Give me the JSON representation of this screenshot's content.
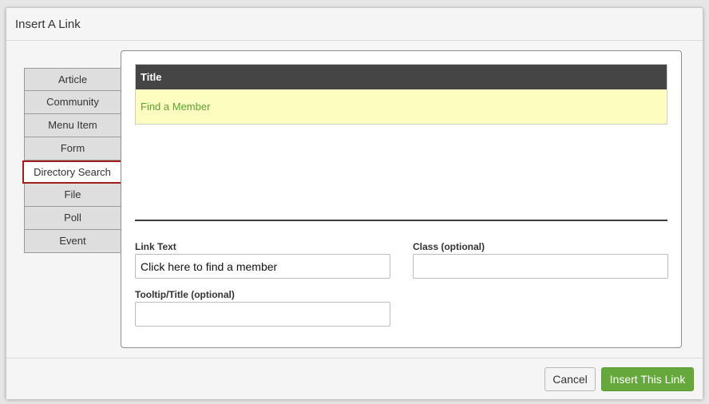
{
  "modal": {
    "title": "Insert A Link"
  },
  "tabs": [
    {
      "label": "Article"
    },
    {
      "label": "Community"
    },
    {
      "label": "Menu Item"
    },
    {
      "label": "Form"
    },
    {
      "label": "Directory Search"
    },
    {
      "label": "File"
    },
    {
      "label": "Poll"
    },
    {
      "label": "Event"
    }
  ],
  "active_tab": "Directory Search",
  "results": {
    "header": "Title",
    "rows": [
      {
        "title": "Find a Member"
      }
    ]
  },
  "form": {
    "link_text_label": "Link Text",
    "link_text_value": "Click here to find a member",
    "class_label": "Class (optional)",
    "class_value": "",
    "tooltip_label": "Tooltip/Title (optional)",
    "tooltip_value": ""
  },
  "footer": {
    "cancel_label": "Cancel",
    "insert_label": "Insert This Link"
  },
  "colors": {
    "active_tab_border": "#a31d1d",
    "table_header_bg": "#454545",
    "row_highlight_bg": "#fdfdc0",
    "link_green": "#5aa233",
    "insert_button": "#66a83c"
  }
}
